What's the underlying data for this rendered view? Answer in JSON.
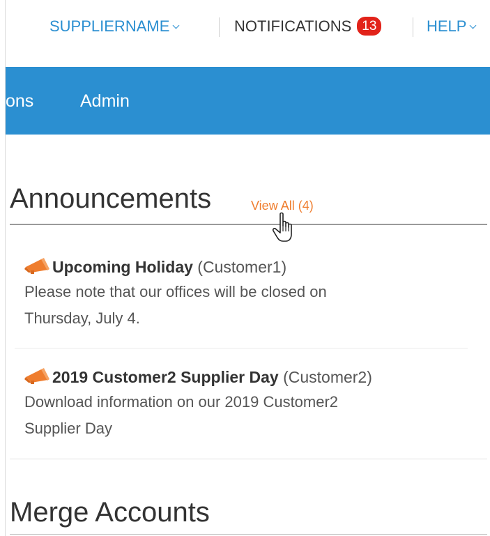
{
  "header": {
    "supplier_label": "SUPPLIERNAME",
    "notifications_label": "NOTIFICATIONS",
    "notifications_count": "13",
    "help_label": "HELP"
  },
  "nav": {
    "items": [
      {
        "label": "ons"
      },
      {
        "label": "Admin"
      }
    ]
  },
  "announcements": {
    "title": "Announcements",
    "view_all_label": "View All (4)",
    "items": [
      {
        "title": "Upcoming Holiday",
        "customer": "(Customer1)",
        "body_line1": "Please note that our offices will be closed on",
        "body_line2": "Thursday, July 4."
      },
      {
        "title": "2019 Customer2 Supplier Day",
        "customer": "(Customer2)",
        "body_line1": "Download information on our 2019 Customer2",
        "body_line2": "Supplier Day"
      }
    ]
  },
  "merge": {
    "title": "Merge Accounts"
  },
  "colors": {
    "brand_blue": "#2b8fd1",
    "badge_red": "#e2231a",
    "link_orange": "#ef7d2e"
  }
}
